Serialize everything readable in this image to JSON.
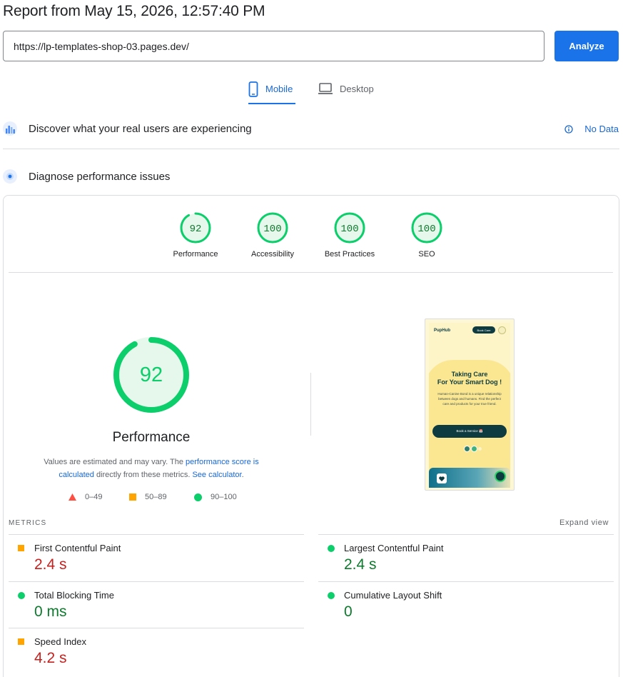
{
  "report": {
    "title": "Report from May 15, 2026, 12:57:40 PM"
  },
  "form": {
    "url": "https://lp-templates-shop-03.pages.dev/",
    "analyze_label": "Analyze"
  },
  "tabs": [
    {
      "label": "Mobile",
      "icon": "mobile-icon",
      "active": true
    },
    {
      "label": "Desktop",
      "icon": "laptop-icon",
      "active": false
    }
  ],
  "crux": {
    "label": "Discover what your real users are experiencing",
    "no_data_label": "No Data",
    "icon": "crux-chart-icon"
  },
  "diagnose": {
    "label": "Diagnose performance issues",
    "icon": "lighthouse-icon"
  },
  "colors": {
    "pass": "#0cce6b",
    "pass_fill": "#e6f7ec",
    "average": "#ffa400",
    "fail": "#ff4e42",
    "accent": "#1a73e8"
  },
  "categories": [
    {
      "label": "Performance",
      "score": "92"
    },
    {
      "label": "Accessibility",
      "score": "100"
    },
    {
      "label": "Best Practices",
      "score": "100"
    },
    {
      "label": "SEO",
      "score": "100"
    }
  ],
  "performance": {
    "score": "92",
    "title": "Performance",
    "disclaimer_prefix": "Values are estimated and may vary. The ",
    "link_score": "performance score is calculated",
    "disclaimer_mid": " directly from these metrics. ",
    "link_calc": "See calculator",
    "disclaimer_suffix": "."
  },
  "legend": [
    {
      "label": "0–49",
      "shape": "triangle"
    },
    {
      "label": "50–89",
      "shape": "square"
    },
    {
      "label": "90–100",
      "shape": "circle"
    }
  ],
  "screenshot": {
    "brand": "PupHub",
    "book_label": "Book Care",
    "headline_1": "Taking Care",
    "headline_2": "For Your Smart Dog !",
    "body": "Human-Canine Bond is a unique relationship between dogs and humans. Find the perfect care and products for your true friend.",
    "cta": "Book a Service 📅"
  },
  "metrics": {
    "heading": "METRICS",
    "expand_label": "Expand view",
    "items": [
      {
        "label": "First Contentful Paint",
        "value": "2.4 s",
        "rating": "average"
      },
      {
        "label": "Largest Contentful Paint",
        "value": "2.4 s",
        "rating": "pass"
      },
      {
        "label": "Total Blocking Time",
        "value": "0 ms",
        "rating": "pass"
      },
      {
        "label": "Cumulative Layout Shift",
        "value": "0",
        "rating": "pass"
      },
      {
        "label": "Speed Index",
        "value": "4.2 s",
        "rating": "average"
      }
    ]
  }
}
